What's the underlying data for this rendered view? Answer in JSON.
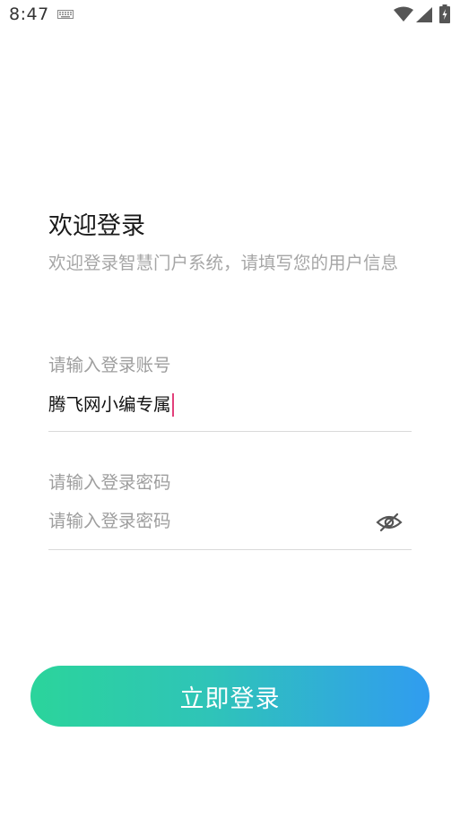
{
  "status_bar": {
    "time": "8:47",
    "icons": [
      "keyboard-icon",
      "wifi-icon",
      "signal-icon",
      "battery-charging-icon"
    ]
  },
  "login": {
    "title": "欢迎登录",
    "subtitle": "欢迎登录智慧门户系统，请填写您的用户信息",
    "account": {
      "label": "请输入登录账号",
      "value": "腾飞网小编专属"
    },
    "password": {
      "label": "请输入登录密码",
      "placeholder": "请输入登录密码",
      "toggle_icon": "eye-off-icon"
    },
    "submit_label": "立即登录"
  },
  "colors": {
    "button_gradient_start": "#2bd49b",
    "button_gradient_end": "#309cf0",
    "caret": "#e2407a",
    "label_gray": "#9e9e9e"
  }
}
